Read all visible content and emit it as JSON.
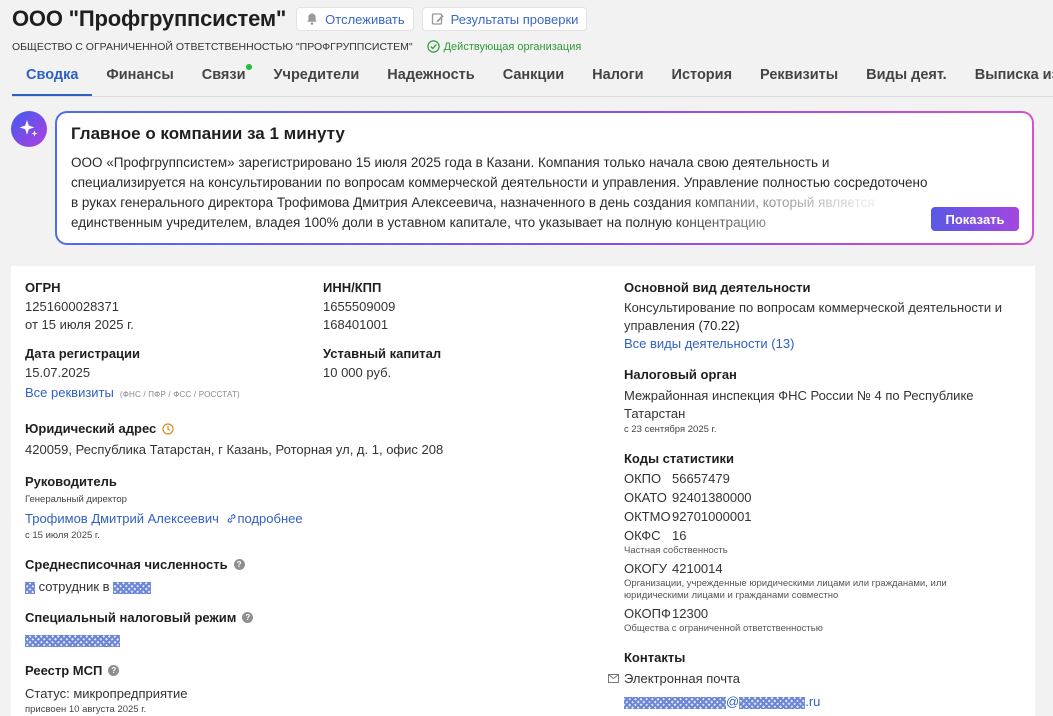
{
  "header": {
    "company_name": "ООО \"Профгруппсистем\"",
    "track_button": "Отслеживать",
    "results_button": "Результаты проверки",
    "full_name": "ОБЩЕСТВО С ОГРАНИЧЕННОЙ ОТВЕТСТВЕННОСТЬЮ \"ПРОФГРУППСИСТЕМ\"",
    "status": "Действующая организация"
  },
  "tabs": [
    "Сводка",
    "Финансы",
    "Связи",
    "Учредители",
    "Надежность",
    "Санкции",
    "Налоги",
    "История",
    "Реквизиты",
    "Виды деят.",
    "Выписка из"
  ],
  "ai_summary": {
    "title": "Главное о компании за 1 минуту",
    "text": "ООО «Профгруппсистем» зарегистрировано 15 июля 2025 года в Казани. Компания только начала свою деятельность и специализируется на консультировании по вопросам коммерческой деятельности и управления. Управление полностью сосредоточено в руках генерального директора Трофимова Дмитрия Алексеевича, назначенного в день создания компании, который является единственным учредителем, владея 100% доли в уставном капитале, что указывает на полную концентрацию",
    "show_button": "Показать"
  },
  "details": {
    "ogrn_label": "ОГРН",
    "ogrn_value": "1251600028371",
    "ogrn_date": "от 15 июля 2025 г.",
    "inn_label": "ИНН/КПП",
    "inn_value": "1655509009",
    "kpp_value": "168401001",
    "reg_date_label": "Дата регистрации",
    "reg_date_value": "15.07.2025",
    "capital_label": "Уставный капитал",
    "capital_value": "10 000 руб.",
    "all_requisites": "Все реквизиты",
    "requisites_sources": "(ФНС / ПФР / ФСС / РОССТАТ)",
    "address_label": "Юридический адрес",
    "address_value": "420059, Республика Татарстан, г Казань, Роторная ул, д. 1, офис 208",
    "head_label": "Руководитель",
    "head_position": "Генеральный директор",
    "head_name": "Трофимов Дмитрий Алексеевич",
    "head_more": "подробнее",
    "head_since": "с 15 июля 2025 г.",
    "staff_label": "Среднесписочная численность",
    "staff_text": "сотрудник в",
    "tax_regime_label": "Специальный налоговый режим",
    "msp_label": "Реестр МСП",
    "msp_status": "Статус: микропредприятие",
    "msp_assigned": "присвоен 10 августа 2025 г."
  },
  "right": {
    "activity_label": "Основной вид деятельности",
    "activity_value": "Консультирование по вопросам коммерческой деятельности и управления",
    "activity_code": "(70.22)",
    "activity_all": "Все виды деятельности (13)",
    "tax_org_label": "Налоговый орган",
    "tax_org_value": "Межрайонная инспекция ФНС России № 4 по Республике Татарстан",
    "tax_org_since": "с 23 сентября 2025 г.",
    "stats_label": "Коды статистики",
    "okpo_k": "ОКПО",
    "okpo_v": "56657479",
    "okato_k": "ОКАТО",
    "okato_v": "92401380000",
    "oktmo_k": "ОКТМО",
    "oktmo_v": "92701000001",
    "okfs_k": "ОКФС",
    "okfs_v": "16",
    "okfs_note": "Частная собственность",
    "okogu_k": "ОКОГУ",
    "okogu_v": "4210014",
    "okogu_note": "Организации, учрежденные юридическими лицами или гражданами, или юридическими лицами и гражданами совместно",
    "okopf_k": "ОКОПФ",
    "okopf_v": "12300",
    "okopf_note": "Общества с ограниченной ответственностью",
    "contacts_label": "Контакты",
    "email_label": "Электронная почта",
    "email_domain": ".ru"
  }
}
